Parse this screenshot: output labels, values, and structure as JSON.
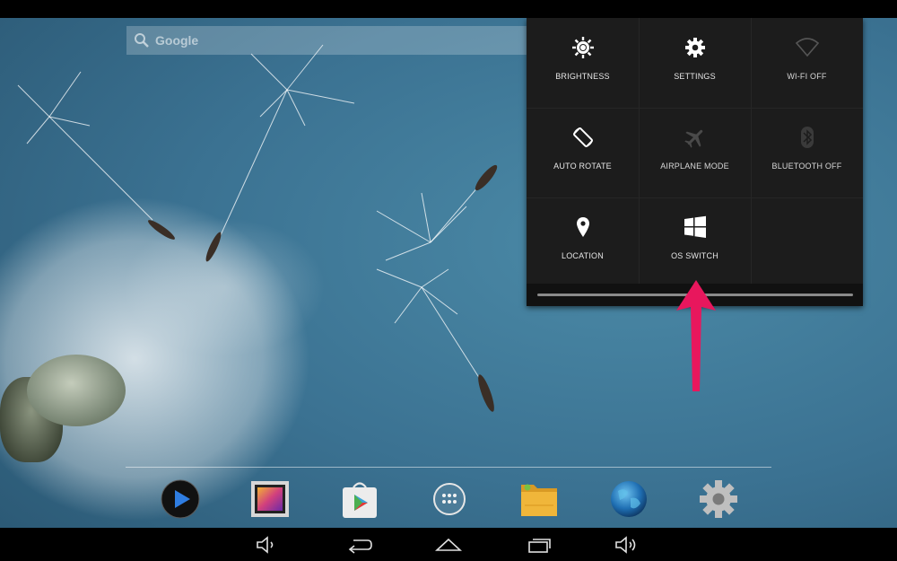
{
  "search": {
    "label": "Google"
  },
  "quick_settings": {
    "tiles": [
      {
        "label": "BRIGHTNESS",
        "icon": "brightness-icon"
      },
      {
        "label": "SETTINGS",
        "icon": "gear-icon"
      },
      {
        "label": "WI-FI OFF",
        "icon": "wifi-icon"
      },
      {
        "label": "AUTO ROTATE",
        "icon": "rotate-icon"
      },
      {
        "label": "AIRPLANE MODE",
        "icon": "airplane-icon"
      },
      {
        "label": "BLUETOOTH OFF",
        "icon": "bluetooth-icon"
      },
      {
        "label": "LOCATION",
        "icon": "location-icon"
      },
      {
        "label": "OS SWITCH",
        "icon": "windows-icon"
      }
    ]
  },
  "dock": {
    "apps": [
      "video-player-icon",
      "gallery-icon",
      "play-store-icon",
      "app-drawer-icon",
      "file-manager-icon",
      "browser-globe-icon",
      "settings-app-icon"
    ]
  },
  "nav_bar": {
    "buttons": [
      "volume-down-icon",
      "back-icon",
      "home-icon",
      "recent-apps-icon",
      "volume-up-icon"
    ]
  },
  "colors": {
    "arrow": "#e8175d",
    "panel": "#1c1c1c"
  }
}
